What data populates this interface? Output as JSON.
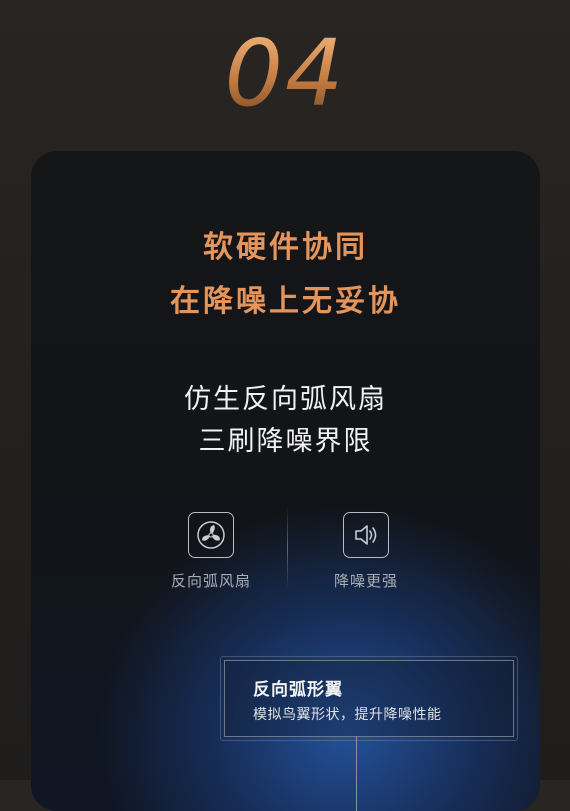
{
  "section_number": "04",
  "card": {
    "headline": [
      "软硬件协同",
      "在降噪上无妥协"
    ],
    "subhead": [
      "仿生反向弧风扇",
      "三刷降噪界限"
    ],
    "features": [
      {
        "icon": "fan-icon",
        "label": "反向弧风扇"
      },
      {
        "icon": "speaker-icon",
        "label": "降噪更强"
      }
    ],
    "callout": {
      "title": "反向弧形翼",
      "desc": "模拟鸟翼形状，提升降噪性能"
    }
  },
  "colors": {
    "accent_orange": "#e4955b",
    "background": "#24211e",
    "card_blue_glow": "#2554a0"
  }
}
